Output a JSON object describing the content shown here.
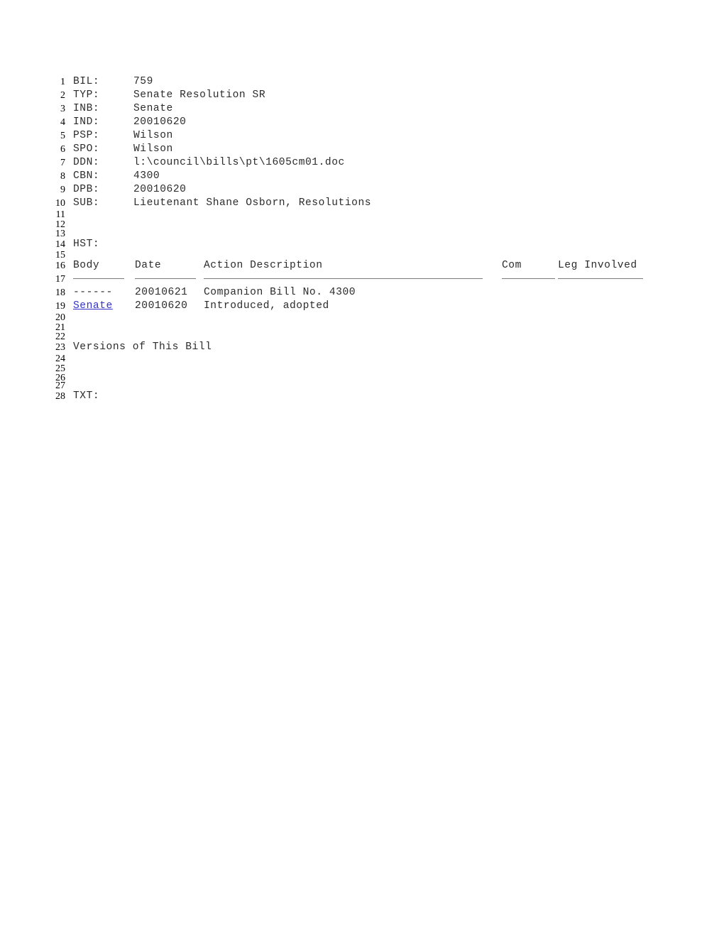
{
  "document": {
    "type": "legislative-bill-listing",
    "link_color": "#3333cc",
    "text_color": "#2b2b2b"
  },
  "fields": [
    {
      "line": "1",
      "label": "BIL:",
      "value": "759"
    },
    {
      "line": "2",
      "label": "TYP:",
      "value": "Senate Resolution SR"
    },
    {
      "line": "3",
      "label": "INB:",
      "value": "Senate"
    },
    {
      "line": "4",
      "label": "IND:",
      "value": "20010620"
    },
    {
      "line": "5",
      "label": "PSP:",
      "value": "Wilson"
    },
    {
      "line": "6",
      "label": "SPO:",
      "value": "Wilson"
    },
    {
      "line": "7",
      "label": "DDN:",
      "value": "l:\\council\\bills\\pt\\1605cm01.doc"
    },
    {
      "line": "8",
      "label": "CBN:",
      "value": "4300"
    },
    {
      "line": "9",
      "label": "DPB:",
      "value": "20010620"
    },
    {
      "line": "10",
      "label": "SUB:",
      "value": "Lieutenant Shane Osborn, Resolutions"
    }
  ],
  "blank_lines": {
    "l11": "11",
    "l12": "12",
    "l13": "13",
    "l15": "15",
    "l17": "17",
    "l20": "20",
    "l21": "21",
    "l22": "22",
    "l24": "24",
    "l25": "25",
    "l26": "26",
    "l27": "27"
  },
  "history": {
    "line_hst": "14",
    "hst_label": "HST:",
    "line_header": "16",
    "headers": {
      "body": "Body",
      "date": "Date",
      "action": "Action Description",
      "com": "Com",
      "leg": "Leg Involved"
    },
    "rows": [
      {
        "line": "18",
        "body": "------",
        "body_is_link": false,
        "date": "20010621",
        "action": "Companion Bill No. 4300",
        "com": "",
        "leg": ""
      },
      {
        "line": "19",
        "body": "Senate",
        "body_is_link": true,
        "date": "20010620",
        "action": "Introduced, adopted",
        "com": "",
        "leg": ""
      }
    ]
  },
  "versions": {
    "line": "23",
    "heading": "Versions of This Bill"
  },
  "text_section": {
    "line": "28",
    "label": "TXT:"
  }
}
